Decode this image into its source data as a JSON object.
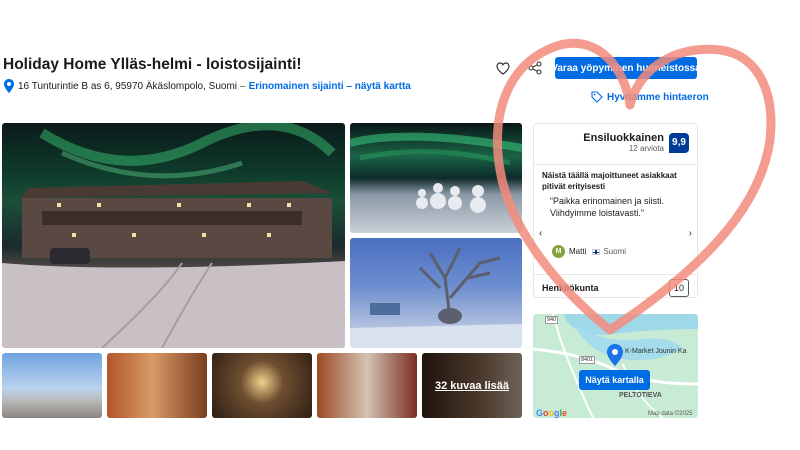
{
  "property": {
    "title": "Holiday Home Ylläs-helmi - loistosijainti!",
    "address": "16 Tunturintie B as 6, 95970 Äkäslompolo, Suomi",
    "separator": "–",
    "map_link": "Erinomainen sijainti – näytä kartta"
  },
  "actions": {
    "reserve_label": "Varaa yöpyminen huoneistossa",
    "price_match_label": "Hyvitämme hintaeron"
  },
  "gallery": {
    "more_photos_label": "32 kuvaa lisää"
  },
  "review_panel": {
    "rating_label": "Ensiluokkainen",
    "review_count": "12 arviota",
    "score": "9,9",
    "intro": "Näistä täällä majoittuneet asiakkaat pitivät erityisesti",
    "quote": "“Paikka erinomainen ja siisti. Viihdyimme loistavasti.”",
    "reviewer_initial": "M",
    "reviewer_name": "Matti",
    "reviewer_country": "Suomi",
    "staff_label": "Henkilökunta",
    "staff_score": "10"
  },
  "map": {
    "button_label": "Näytä kartalla",
    "poi_label": "K-Market Jounin Ka",
    "area_label": "PELTOTIEVA",
    "road_1": "940",
    "road_2": "8401",
    "copyright": "Map data ©2025",
    "google": "Google"
  },
  "colors": {
    "primary": "#006ce4",
    "score_bg": "#003b95",
    "heart_overlay": "#f28b7d"
  }
}
